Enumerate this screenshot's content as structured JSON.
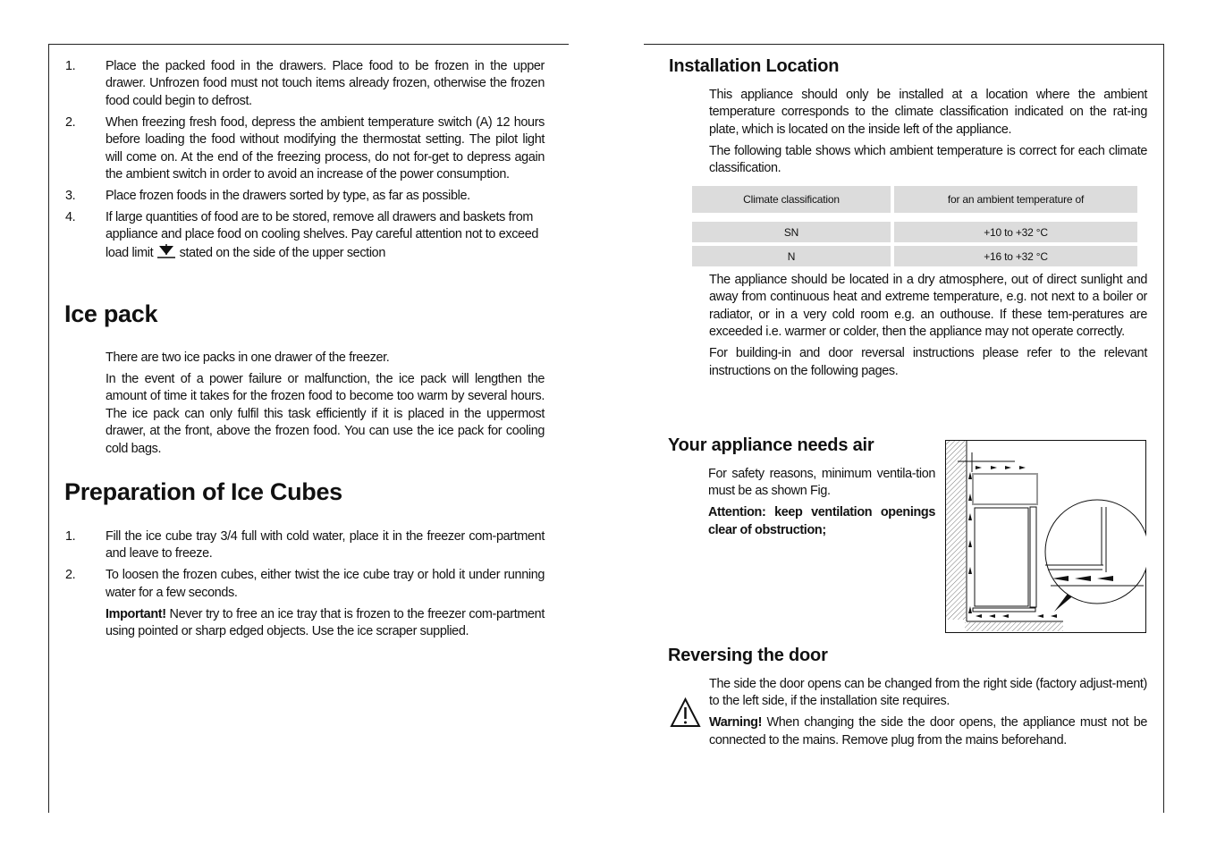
{
  "left": {
    "freezing_steps": [
      {
        "num": "1.",
        "text": "Place the packed food in the drawers. Place food to be frozen in the upper drawer. Unfrozen food must not touch items already frozen, otherwise the frozen food could begin to defrost."
      },
      {
        "num": "2.",
        "text": "When freezing fresh food, depress the ambient temperature switch (A) 12 hours before loading the food without modifying the thermostat setting. The pilot light will come on. At the end of the freezing process, do not for-get to depress again the ambient switch in order to avoid an increase of the power consumption."
      },
      {
        "num": "3.",
        "text": "Place frozen foods in the drawers sorted by type, as far as possible."
      },
      {
        "num": "4.",
        "text_before": "If large quantities of food are to be stored, remove all drawers and baskets from appliance and place food on cooling shelves. Pay careful attention not to exceed load limit",
        "icon": "load-limit-icon",
        "text_after": "stated on the side of the upper section"
      }
    ],
    "ice_pack": {
      "title": "Ice pack",
      "paragraphs": [
        "There are two ice packs in one drawer of the freezer.",
        "In the event of a power failure or malfunction, the ice pack will lengthen the amount of time it takes for the frozen food to become too warm by several hours. The ice pack can only fulfil this task efficiently if it is placed in the uppermost drawer, at the front, above the frozen food. You can use the ice pack for cooling cold bags."
      ]
    },
    "ice_cubes": {
      "title": "Preparation of Ice Cubes",
      "steps": [
        {
          "num": "1.",
          "text": "Fill the ice cube tray 3/4 full with cold water, place it in the freezer com-partment and leave to freeze."
        },
        {
          "num": "2.",
          "text": "To loosen the frozen cubes, either twist the ice cube tray or hold it under running water for a few seconds."
        }
      ],
      "important_label": "Important!",
      "important_text": " Never try to free an ice tray that is frozen to the freezer com-partment using pointed or sharp edged objects. Use the ice scraper supplied."
    }
  },
  "right": {
    "installation": {
      "title": "Installation Location",
      "intro": [
        "This appliance should only be installed at a location where the ambient temperature corresponds to the climate classification indicated on the rat-ing plate, which is located on the inside left of the appliance.",
        "The following table shows which ambient temperature is correct for each climate classification."
      ],
      "table": {
        "headers": [
          "Climate classification",
          "for an ambient temperature of"
        ],
        "rows": [
          [
            "SN",
            "+10 to +32 °C"
          ],
          [
            "N",
            "+16 to +32 °C"
          ]
        ]
      },
      "after": [
        "The appliance should be located in a dry atmosphere, out of direct sunlight and away from continuous heat and extreme temperature, e.g. not next to a boiler or radiator, or in a very cold room e.g. an outhouse. If these tem-peratures are exceeded i.e. warmer or colder, then the appliance may not operate correctly.",
        "For building-in and door reversal instructions please refer to the relevant instructions on the following pages."
      ]
    },
    "air": {
      "title": "Your appliance needs air",
      "text": "For safety reasons, minimum ventila-tion must be as shown Fig.",
      "attention": "Attention: keep ventilation openings clear of obstruction;"
    },
    "door": {
      "title": "Reversing the door",
      "text": "The side  the door opens can be changed from the right side (factory adjust-ment) to the left side, if the installation site requires.",
      "warning_label": "Warning!",
      "warning_text": " When changing the side the door opens, the appliance must not be connected to the mains. Remove plug from the mains beforehand.",
      "icon": "warning-triangle-icon"
    }
  }
}
